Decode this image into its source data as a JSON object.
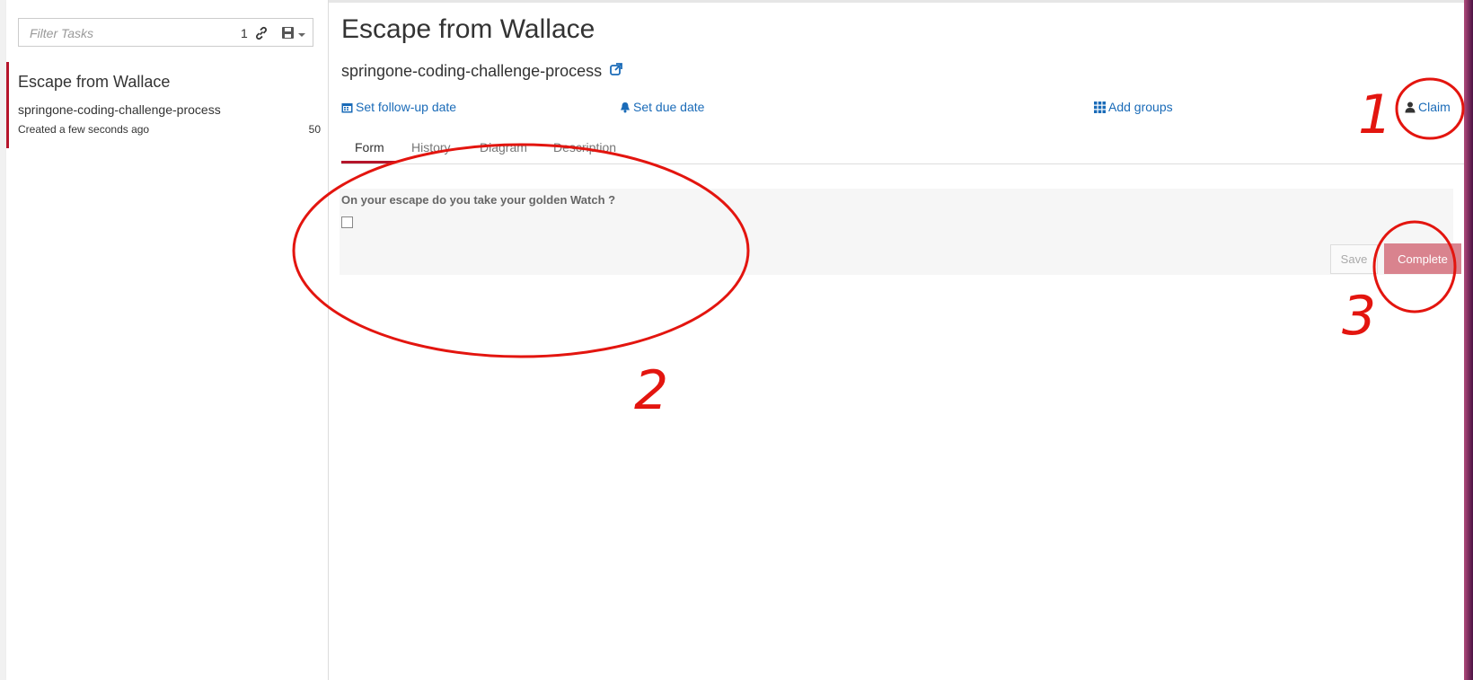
{
  "sidebar": {
    "filter_placeholder": "Filter Tasks",
    "task_count": "1",
    "tasks": [
      {
        "name": "Escape from Wallace",
        "process": "springone-coding-challenge-process",
        "created": "Created a few seconds ago",
        "priority": "50"
      }
    ]
  },
  "task": {
    "title": "Escape from Wallace",
    "process_name": "springone-coding-challenge-process",
    "actions": {
      "follow_up": "Set follow-up date",
      "due": "Set due date",
      "groups": "Add groups",
      "claim": "Claim"
    },
    "tabs": [
      "Form",
      "History",
      "Diagram",
      "Description"
    ],
    "active_tab": "Form"
  },
  "form": {
    "question": "On your escape do you take your golden Watch ?",
    "checkbox_checked": false,
    "save_label": "Save",
    "complete_label": "Complete"
  },
  "annotations": {
    "numbers": [
      "1",
      "2",
      "3"
    ],
    "color": "#e3150f"
  },
  "colors": {
    "accent": "#b5152b",
    "link": "#1a6bb8",
    "complete_button": "#d9838e"
  }
}
